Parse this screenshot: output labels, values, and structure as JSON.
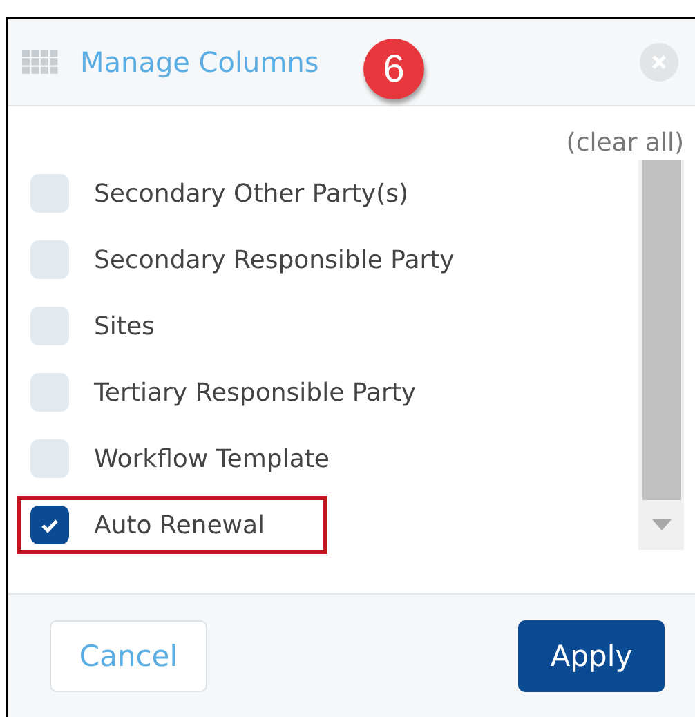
{
  "dialog": {
    "title": "Manage Columns",
    "step_badge": "6",
    "clear_all": "(clear all)",
    "columns": [
      {
        "label": "Secondary Other Party(s)",
        "checked": false,
        "highlighted": false
      },
      {
        "label": "Secondary Responsible Party",
        "checked": false,
        "highlighted": false
      },
      {
        "label": "Sites",
        "checked": false,
        "highlighted": false
      },
      {
        "label": "Tertiary Responsible Party",
        "checked": false,
        "highlighted": false
      },
      {
        "label": "Workflow Template",
        "checked": false,
        "highlighted": false
      },
      {
        "label": "Auto Renewal",
        "checked": true,
        "highlighted": true
      }
    ],
    "buttons": [
      {
        "label": "Cancel",
        "kind": "secondary"
      },
      {
        "label": "Apply",
        "kind": "primary"
      }
    ]
  }
}
